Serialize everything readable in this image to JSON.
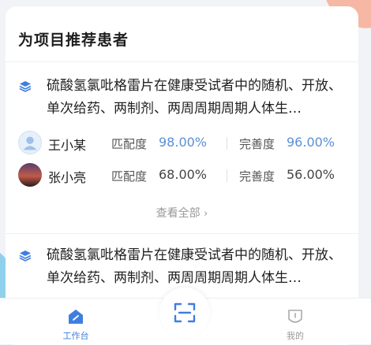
{
  "card": {
    "title": "为项目推荐患者"
  },
  "trials": [
    {
      "icon": "layers-icon",
      "title": "硫酸氢氯吡格雷片在健康受试者中的随机、开放、单次给药、两制剂、两周周期周期人体生…",
      "patients": [
        {
          "name": "王小某",
          "match_label": "匹配度",
          "match_value": "98.00%",
          "complete_label": "完善度",
          "complete_value": "96.00%",
          "highlight": true
        },
        {
          "name": "张小亮",
          "match_label": "匹配度",
          "match_value": "68.00%",
          "complete_label": "完善度",
          "complete_value": "56.00%",
          "highlight": false
        }
      ],
      "view_all": "查看全部"
    },
    {
      "icon": "layers-icon",
      "title": "硫酸氢氯吡格雷片在健康受试者中的随机、开放、单次给药、两制剂、两周周期周期人体生…"
    }
  ],
  "tabbar": {
    "items": [
      {
        "label": "工作台",
        "icon": "workbench-icon",
        "active": true
      },
      {
        "label": "",
        "icon": "scan-icon",
        "active": false
      },
      {
        "label": "我的",
        "icon": "profile-icon",
        "active": false
      }
    ]
  },
  "colors": {
    "accent": "#3f7ee0",
    "value_blue": "#5b8fd6",
    "inactive": "#999999"
  }
}
